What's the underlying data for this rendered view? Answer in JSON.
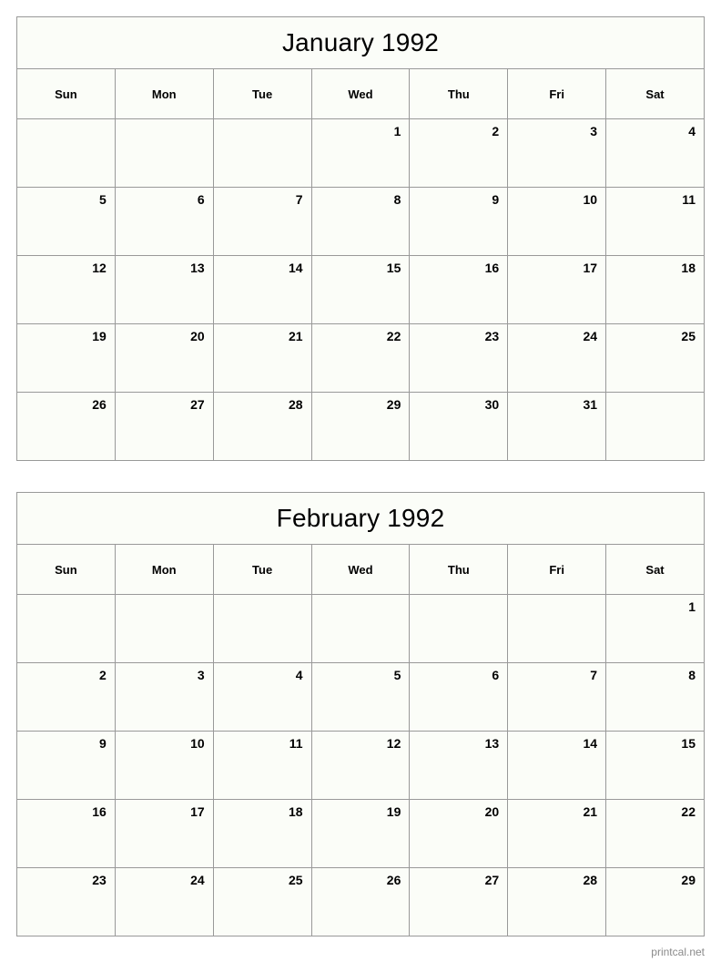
{
  "page": {
    "background_color": "#ffffff",
    "cell_background_color": "#fbfdf8",
    "border_color": "#999999",
    "text_color": "#000000",
    "footer_color": "#8a8a8a"
  },
  "footer": {
    "text": "printcal.net"
  },
  "calendars": [
    {
      "title": "January 1992",
      "weekday_headers": [
        "Sun",
        "Mon",
        "Tue",
        "Wed",
        "Thu",
        "Fri",
        "Sat"
      ],
      "weeks": [
        [
          "",
          "",
          "",
          "1",
          "2",
          "3",
          "4"
        ],
        [
          "5",
          "6",
          "7",
          "8",
          "9",
          "10",
          "11"
        ],
        [
          "12",
          "13",
          "14",
          "15",
          "16",
          "17",
          "18"
        ],
        [
          "19",
          "20",
          "21",
          "22",
          "23",
          "24",
          "25"
        ],
        [
          "26",
          "27",
          "28",
          "29",
          "30",
          "31",
          ""
        ]
      ]
    },
    {
      "title": "February 1992",
      "weekday_headers": [
        "Sun",
        "Mon",
        "Tue",
        "Wed",
        "Thu",
        "Fri",
        "Sat"
      ],
      "weeks": [
        [
          "",
          "",
          "",
          "",
          "",
          "",
          "1"
        ],
        [
          "2",
          "3",
          "4",
          "5",
          "6",
          "7",
          "8"
        ],
        [
          "9",
          "10",
          "11",
          "12",
          "13",
          "14",
          "15"
        ],
        [
          "16",
          "17",
          "18",
          "19",
          "20",
          "21",
          "22"
        ],
        [
          "23",
          "24",
          "25",
          "26",
          "27",
          "28",
          "29"
        ]
      ]
    }
  ]
}
